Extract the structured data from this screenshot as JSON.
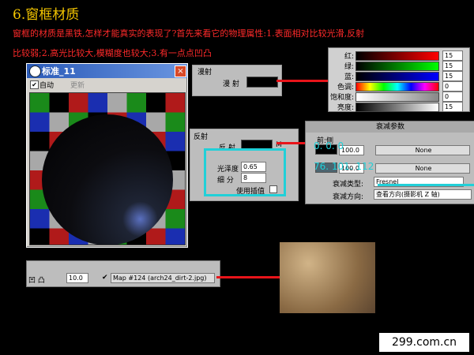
{
  "slide": {
    "title": "6.窗框材质",
    "desc_line1": "窗框的材质是黑铁,怎样才能真实的表现了?首先来看它的物理属性:1.表面相对比较光滑,反射",
    "desc_line2": "比较弱;2.高光比较大,模糊度也较大;3.有一点点凹凸"
  },
  "material_window": {
    "title": "标准_11",
    "auto_label": "自动",
    "update_label": "更新",
    "close": "×"
  },
  "diffuse": {
    "group": "漫射",
    "label": "漫 射"
  },
  "color_picker": {
    "rows": [
      {
        "label": "红:",
        "value": "15"
      },
      {
        "label": "绿:",
        "value": "15"
      },
      {
        "label": "蓝:",
        "value": "15"
      },
      {
        "label": "色调:",
        "value": "0"
      },
      {
        "label": "饱和度:",
        "value": "0"
      },
      {
        "label": "亮度:",
        "value": "15"
      }
    ]
  },
  "specular": {
    "group": "反射",
    "reflect_label": "反 射",
    "m_label": "M",
    "gloss_label": "光泽度",
    "gloss_value": "0.65",
    "subdiv_label": "细 分",
    "subdiv_value": "8",
    "interp_label": "使用插值"
  },
  "falloff": {
    "header": "衰减参数",
    "front_side": "前:侧",
    "row1_value": "100.0",
    "row1_map": "None",
    "row2_value": "100.0",
    "row2_map": "None",
    "overlay1": "0. 0. 0",
    "overlay2": "76. 101. 112",
    "type_label": "衰减类型:",
    "type_value": "Fresnel",
    "dir_label": "衰减方向:",
    "dir_value": "查看方向(摄影机 Z 轴)"
  },
  "map_row": {
    "label": "凹 凸",
    "amount": "10.0",
    "check": "✔",
    "map_text": "Map #124 (arch24_dirt-2.jpg)"
  },
  "watermark": "299.com.cn"
}
